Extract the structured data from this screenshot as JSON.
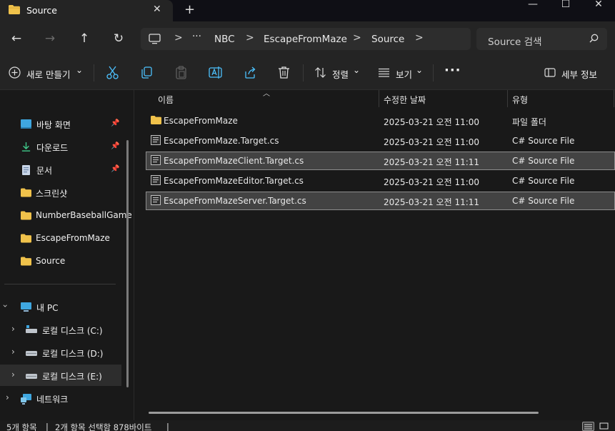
{
  "tab": {
    "title": "Source",
    "close": "✕",
    "new_tab": "+"
  },
  "window": {
    "minimize": "—",
    "maximize": "☐",
    "close": "✕"
  },
  "nav": {
    "back": "←",
    "forward": "→",
    "up": "↑",
    "refresh": "↻"
  },
  "address": {
    "more": "···",
    "segments": [
      "NBC",
      "EscapeFromMaze",
      "Source"
    ],
    "sep": ">"
  },
  "search": {
    "placeholder": "Source 검색"
  },
  "commands": {
    "new_label": "새로 만들기",
    "sort_label": "정렬",
    "view_label": "보기",
    "more": "···",
    "details_label": "세부 정보",
    "chevron": "⌄"
  },
  "sidebar": {
    "quick": [
      {
        "label": "바탕 화면",
        "icon": "desktop-icon",
        "pinned": true
      },
      {
        "label": "다운로드",
        "icon": "download-icon",
        "pinned": true
      },
      {
        "label": "문서",
        "icon": "document-icon",
        "pinned": true
      },
      {
        "label": "스크린샷",
        "icon": "folder-icon",
        "pinned": false
      },
      {
        "label": "NumberBaseballGame",
        "icon": "folder-icon",
        "pinned": false
      },
      {
        "label": "EscapeFromMaze",
        "icon": "folder-icon",
        "pinned": false
      },
      {
        "label": "Source",
        "icon": "folder-icon",
        "pinned": false
      }
    ],
    "pc_label": "내 PC",
    "drives": [
      {
        "label": "로컬 디스크 (C:)",
        "selected": false
      },
      {
        "label": "로컬 디스크 (D:)",
        "selected": false
      },
      {
        "label": "로컬 디스크 (E:)",
        "selected": true
      }
    ],
    "network_label": "네트워크"
  },
  "columns": {
    "name": "이름",
    "date": "수정한 날짜",
    "type": "유형"
  },
  "files": [
    {
      "name": "EscapeFromMaze",
      "date": "2025-03-21 오전 11:00",
      "type": "파일 폴더",
      "icon": "folder-icon",
      "selected": false
    },
    {
      "name": "EscapeFromMaze.Target.cs",
      "date": "2025-03-21 오전 11:00",
      "type": "C# Source File",
      "icon": "cs-file-icon",
      "selected": false
    },
    {
      "name": "EscapeFromMazeClient.Target.cs",
      "date": "2025-03-21 오전 11:11",
      "type": "C# Source File",
      "icon": "cs-file-icon",
      "selected": true
    },
    {
      "name": "EscapeFromMazeEditor.Target.cs",
      "date": "2025-03-21 오전 11:00",
      "type": "C# Source File",
      "icon": "cs-file-icon",
      "selected": false
    },
    {
      "name": "EscapeFromMazeServer.Target.cs",
      "date": "2025-03-21 오전 11:11",
      "type": "C# Source File",
      "icon": "cs-file-icon",
      "selected": true
    }
  ],
  "status": {
    "count": "5개 항목",
    "selection": "2개 항목 선택함 878바이트",
    "sep": "|"
  },
  "colors": {
    "folder": "#f0c24b",
    "accent": "#4cc2ff",
    "selected_row": "#434343"
  }
}
